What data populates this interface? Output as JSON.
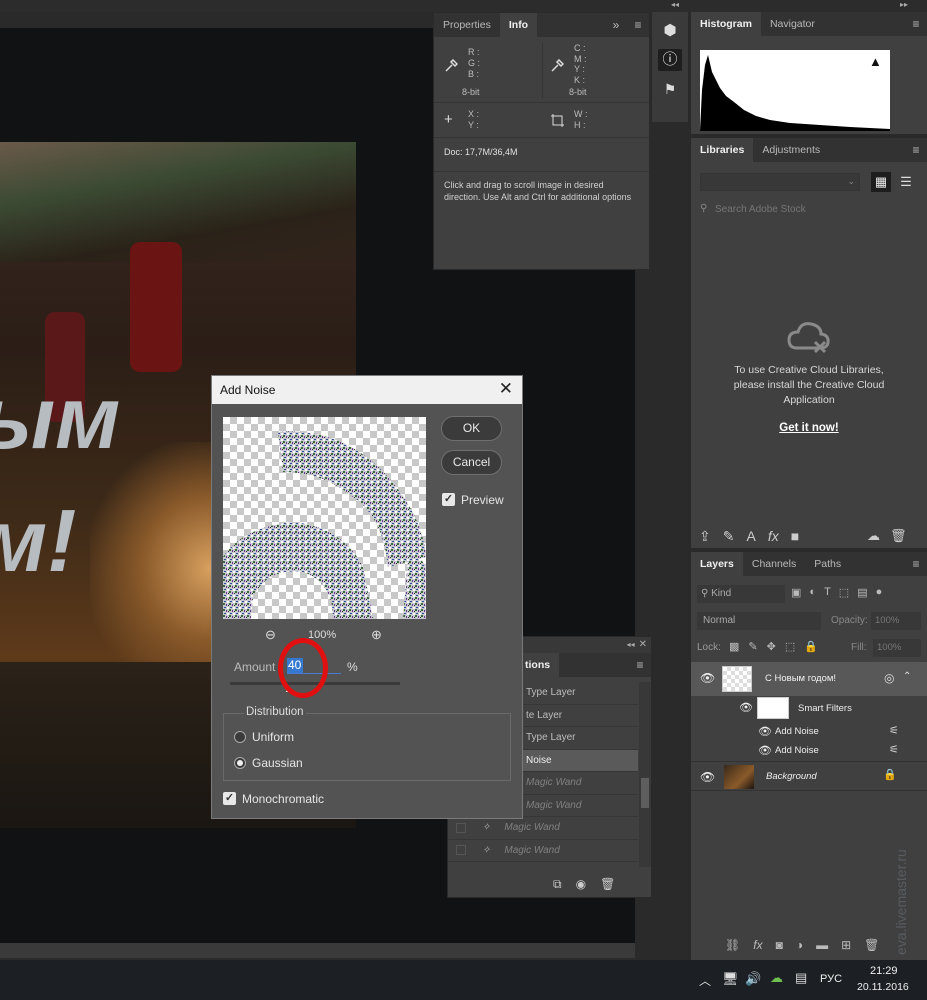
{
  "info_panel": {
    "tabs": [
      "Properties",
      "Info"
    ],
    "rgb_labels": [
      "R :",
      "G :",
      "B :"
    ],
    "cmyk_labels": [
      "C :",
      "M :",
      "Y :",
      "K :"
    ],
    "bit_left": "8-bit",
    "bit_right": "8-bit",
    "xy_labels": [
      "X :",
      "Y :"
    ],
    "wh_labels": [
      "W :",
      "H :"
    ],
    "doc": "Doc: 17,7M/36,4M",
    "hint": "Click and drag to scroll image in desired direction.  Use Alt and Ctrl for additional options"
  },
  "histogram_panel": {
    "tabs": [
      "Histogram",
      "Navigator"
    ]
  },
  "libraries_panel": {
    "tabs": [
      "Libraries",
      "Adjustments"
    ],
    "search_placeholder": "Search Adobe Stock",
    "message": "To use Creative Cloud Libraries, please install the Creative Cloud Application",
    "link": "Get it now!"
  },
  "layers_panel": {
    "tabs": [
      "Layers",
      "Channels",
      "Paths"
    ],
    "kind": "Kind",
    "blend_mode": "Normal",
    "opacity_label": "Opacity:",
    "opacity_value": "100%",
    "lock_label": "Lock:",
    "fill_label": "Fill:",
    "fill_value": "100%",
    "layers": [
      {
        "name": "С Новым  годом!"
      },
      {
        "name": "Smart Filters"
      },
      {
        "name": "Add Noise"
      },
      {
        "name": "Add Noise"
      },
      {
        "name": "Background"
      }
    ]
  },
  "history_panel": {
    "tab": "tions",
    "items": [
      "Type Layer",
      "te Layer",
      "Type Layer",
      "Noise",
      "Magic Wand",
      "Magic Wand",
      "Magic Wand",
      "Magic Wand"
    ]
  },
  "dialog": {
    "title": "Add Noise",
    "ok": "OK",
    "cancel": "Cancel",
    "preview": "Preview",
    "zoom": "100%",
    "amount_label": "Amount",
    "amount_value": "40",
    "amount_unit": "%",
    "distribution_title": "Distribution",
    "uniform": "Uniform",
    "gaussian": "Gaussian",
    "monochromatic": "Monochromatic"
  },
  "canvas": {
    "text_line1": "ым",
    "text_line2": "м!"
  },
  "taskbar": {
    "lang": "РУС",
    "time": "21:29",
    "date": "20.11.2016"
  },
  "watermark": "eva.livemaster.ru"
}
